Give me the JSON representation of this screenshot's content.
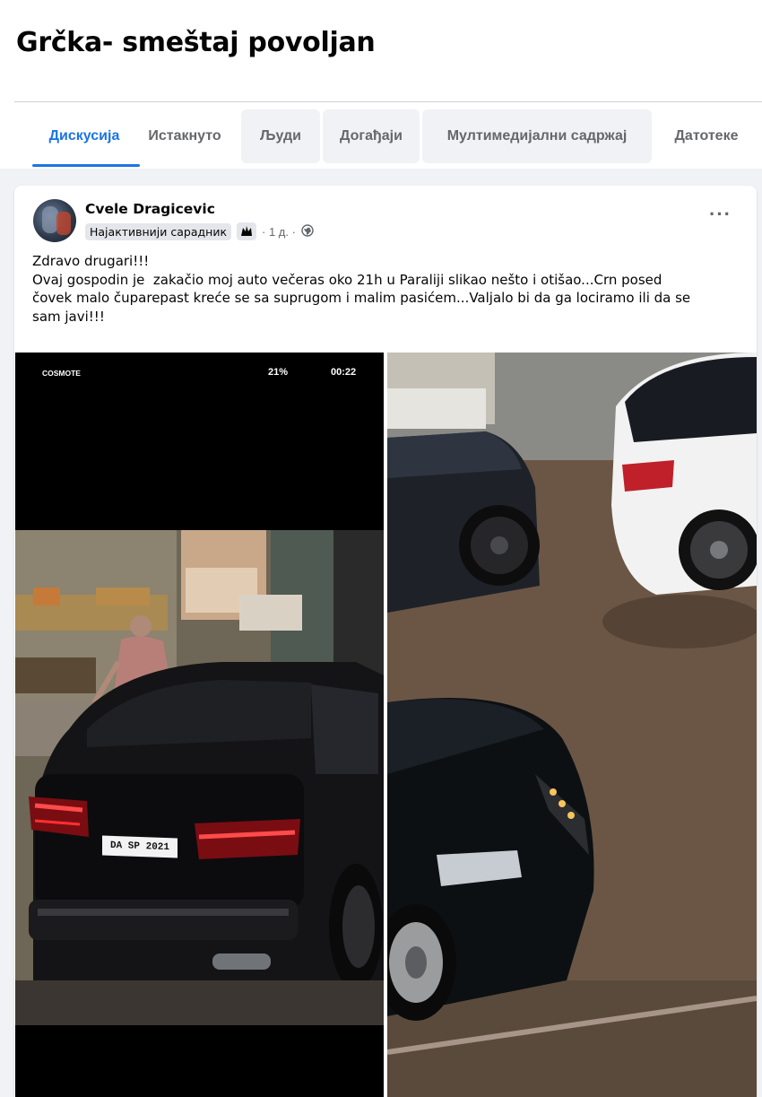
{
  "group": {
    "title": "Grčka- smeštaj povoljan"
  },
  "tabs": [
    {
      "label": "Дискусија",
      "active": true
    },
    {
      "label": "Истакнуто",
      "active": false
    },
    {
      "label": "Људи",
      "active": false
    },
    {
      "label": "Догађаји",
      "active": false
    },
    {
      "label": "Мултимедијални садржај",
      "active": false
    },
    {
      "label": "Датотеке",
      "active": false
    }
  ],
  "post": {
    "author": "Cvele Dragicevic",
    "badge": "Најактивнији сарадник",
    "time": "· 1 д. ·",
    "more_label": "···",
    "text_lines": [
      "Zdravo drugari!!!",
      "Ovaj gospodin je  zakačio moj auto večeras oko 21h u Paraliji slikao nešto i otišao...Crn posed",
      "čovek malo čuparepast kreće se sa suprugom i malim pasićem...Valjalo bi da ga lociramo ili da se",
      "sam javi!!!"
    ],
    "photo_left": {
      "carrier_text": "COSMOTE",
      "battery_text": "21%",
      "clock_text": "00:22",
      "plate_text": "DA SP 2021"
    }
  },
  "colors": {
    "accent": "#1b74e4",
    "page_bg": "#f0f2f5",
    "secondary_text": "#65676b"
  }
}
